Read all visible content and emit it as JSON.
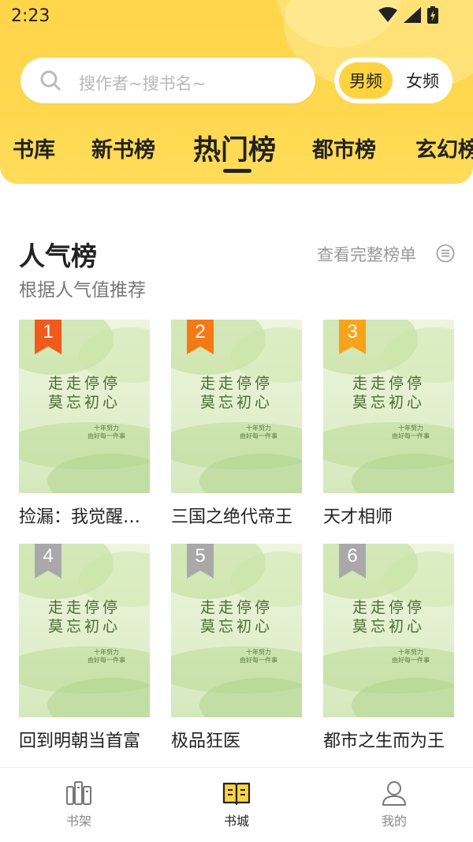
{
  "status_bar": {
    "time": "2:23"
  },
  "search": {
    "placeholder": "搜作者~搜书名~"
  },
  "gender": {
    "male": "男频",
    "female": "女频",
    "selected": "male"
  },
  "tabs": [
    {
      "label": "书库"
    },
    {
      "label": "新书榜"
    },
    {
      "label": "热门榜",
      "active": true
    },
    {
      "label": "都市榜"
    },
    {
      "label": "玄幻榜"
    }
  ],
  "section": {
    "title": "人气榜",
    "subtitle": "根据人气值推荐",
    "view_all": "查看完整榜单"
  },
  "cover": {
    "line1": "走走停停",
    "line2": "莫忘初心",
    "small1": "十年努力",
    "small2": "由好每一件事"
  },
  "books": [
    {
      "rank": "1",
      "name": "捡漏：我觉醒…",
      "badge_color": "#f25a1d"
    },
    {
      "rank": "2",
      "name": "三国之绝代帝王",
      "badge_color": "#f57a16"
    },
    {
      "rank": "3",
      "name": "天才相师",
      "badge_color": "#f7a41a"
    },
    {
      "rank": "4",
      "name": "回到明朝当首富",
      "badge_color": "#a9a9a9"
    },
    {
      "rank": "5",
      "name": "极品狂医",
      "badge_color": "#a9a9a9"
    },
    {
      "rank": "6",
      "name": "都市之生而为王",
      "badge_color": "#a9a9a9"
    }
  ],
  "bottom_nav": [
    {
      "label": "书架",
      "icon": "bookshelf-icon"
    },
    {
      "label": "书城",
      "icon": "open-book-icon",
      "active": true
    },
    {
      "label": "我的",
      "icon": "person-icon"
    }
  ],
  "colors": {
    "header": "#ffd54a",
    "accent": "#ffd33f"
  }
}
